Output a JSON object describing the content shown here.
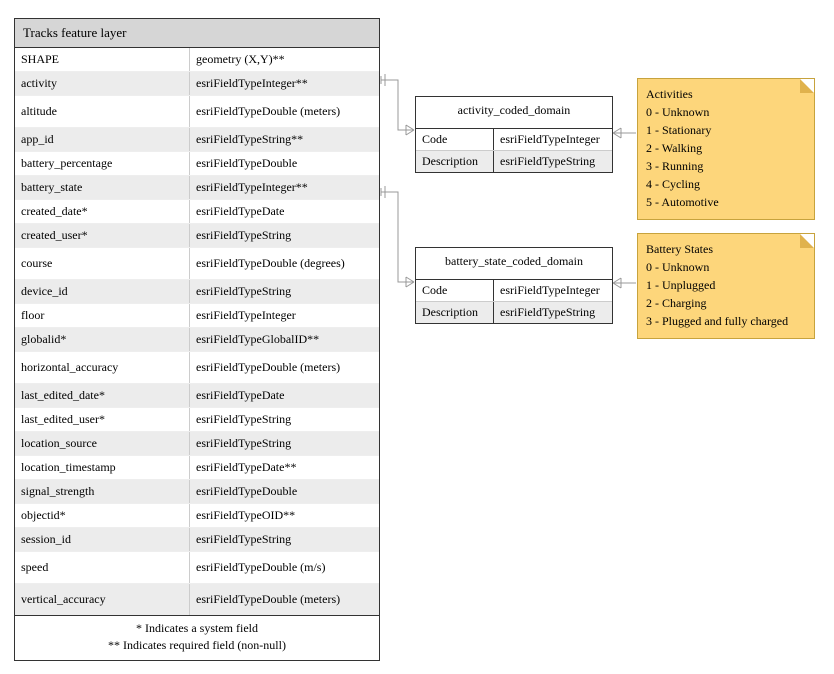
{
  "main": {
    "title": "Tracks feature layer",
    "rows": [
      {
        "name": "SHAPE",
        "type": "geometry (X,Y)**",
        "shaded": false
      },
      {
        "name": "activity",
        "type": "esriFieldTypeInteger**",
        "shaded": true
      },
      {
        "name": "altitude",
        "type": "esriFieldTypeDouble (meters)",
        "shaded": false,
        "tall": true
      },
      {
        "name": "app_id",
        "type": "esriFieldTypeString**",
        "shaded": true
      },
      {
        "name": "battery_percentage",
        "type": "esriFieldTypeDouble",
        "shaded": false
      },
      {
        "name": "battery_state",
        "type": "esriFieldTypeInteger**",
        "shaded": true
      },
      {
        "name": "created_date*",
        "type": "esriFieldTypeDate",
        "shaded": false
      },
      {
        "name": "created_user*",
        "type": "esriFieldTypeString",
        "shaded": true
      },
      {
        "name": "course",
        "type": "esriFieldTypeDouble (degrees)",
        "shaded": false,
        "tall": true
      },
      {
        "name": "device_id",
        "type": "esriFieldTypeString",
        "shaded": true
      },
      {
        "name": "floor",
        "type": "esriFieldTypeInteger",
        "shaded": false
      },
      {
        "name": "globalid*",
        "type": "esriFieldTypeGlobalID**",
        "shaded": true
      },
      {
        "name": "horizontal_accuracy",
        "type": "esriFieldTypeDouble (meters)",
        "shaded": false,
        "tall": true
      },
      {
        "name": "last_edited_date*",
        "type": "esriFieldTypeDate",
        "shaded": true
      },
      {
        "name": "last_edited_user*",
        "type": "esriFieldTypeString",
        "shaded": false
      },
      {
        "name": "location_source",
        "type": "esriFieldTypeString",
        "shaded": true
      },
      {
        "name": "location_timestamp",
        "type": "esriFieldTypeDate**",
        "shaded": false
      },
      {
        "name": "signal_strength",
        "type": "esriFieldTypeDouble",
        "shaded": true
      },
      {
        "name": "objectid*",
        "type": "esriFieldTypeOID**",
        "shaded": false
      },
      {
        "name": "session_id",
        "type": "esriFieldTypeString",
        "shaded": true
      },
      {
        "name": "speed",
        "type": "esriFieldTypeDouble (m/s)",
        "shaded": false,
        "tall": true
      },
      {
        "name": "vertical_accuracy",
        "type": "esriFieldTypeDouble (meters)",
        "shaded": true,
        "tall": true
      }
    ],
    "footer1": "* Indicates a system field",
    "footer2": "** Indicates required field (non-null)"
  },
  "domain1": {
    "title": "activity_coded_domain",
    "rows": [
      {
        "k": "Code",
        "v": "esriFieldTypeInteger",
        "shaded": false
      },
      {
        "k": "Description",
        "v": "esriFieldTypeString",
        "shaded": true
      }
    ]
  },
  "domain2": {
    "title": "battery_state_coded_domain",
    "rows": [
      {
        "k": "Code",
        "v": "esriFieldTypeInteger",
        "shaded": false
      },
      {
        "k": "Description",
        "v": "esriFieldTypeString",
        "shaded": true
      }
    ]
  },
  "note1": {
    "title": "Activities",
    "items": [
      "0 - Unknown",
      "1 - Stationary",
      "2 - Walking",
      "3 - Running",
      "4 - Cycling",
      "5 - Automotive"
    ]
  },
  "note2": {
    "title": "Battery States",
    "items": [
      "0 - Unknown",
      "1 - Unplugged",
      "2 - Charging",
      "3 - Plugged and fully charged"
    ]
  }
}
